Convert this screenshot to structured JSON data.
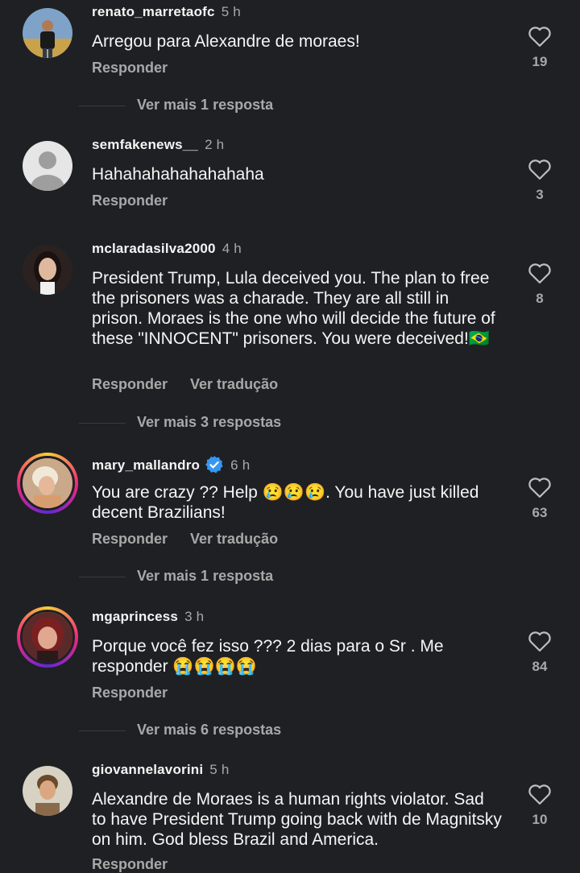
{
  "ui": {
    "reply_label": "Responder",
    "translate_label": "Ver tradução"
  },
  "comments": [
    {
      "username": "renato_marretaofc",
      "time": "5 h",
      "text": "Arregou para Alexandre de moraes!",
      "likes": "19",
      "more_replies": "Ver mais 1 resposta"
    },
    {
      "username": "semfakenews__",
      "time": "2 h",
      "text": "Hahahahahahahahaha",
      "likes": "3"
    },
    {
      "username": "mclaradasilva2000",
      "time": "4 h",
      "text": "President Trump, Lula deceived you. The plan to free the prisoners was a charade. They are all still in prison. Moraes is the one who will decide the future of these \"INNOCENT\" prisoners. You were deceived!🇧🇷",
      "likes": "8",
      "more_replies": "Ver mais 3 respostas"
    },
    {
      "username": "mary_mallandro",
      "time": "6 h",
      "text": "You are crazy ?? Help 😢😢😢. You have just killed decent Brazilians!",
      "likes": "63",
      "verified": true,
      "more_replies": "Ver mais 1 resposta"
    },
    {
      "username": "mgaprincess",
      "time": "3 h",
      "text": "Porque você fez isso ??? 2 dias para o Sr . Me responder 😭😭😭😭",
      "likes": "84",
      "more_replies": "Ver mais 6 respostas"
    },
    {
      "username": "giovannelavorini",
      "time": "5 h",
      "text": "Alexandre de Moraes is a human rights violator. Sad to have President Trump going back with de Magnitsky on him. God bless Brazil and America.",
      "likes": "10"
    }
  ]
}
